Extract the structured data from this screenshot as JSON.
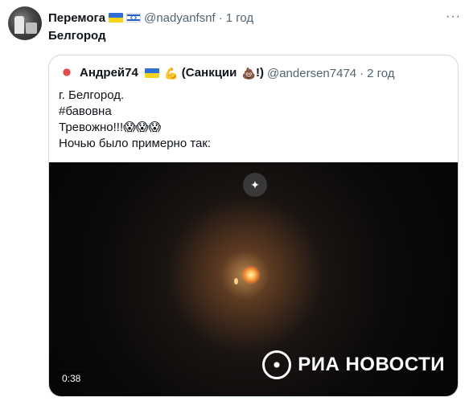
{
  "tweet": {
    "display_name": "Перемога",
    "handle": "@nadyanfsnf",
    "separator": "·",
    "time": "1 год",
    "text": "Белгород",
    "more_icon": "more-dots-icon"
  },
  "quote": {
    "display_name": "Андрей74",
    "sanctions_open": "(Санкции",
    "sanctions_close": "!)",
    "handle": "@andersen7474",
    "separator": "·",
    "time": "2 год",
    "lines": [
      "г. Белгород.",
      "#бавовна",
      "Тревожно!!!😱😱😱",
      "Ночью было примерно так:"
    ],
    "emoji_muscle": "💪",
    "emoji_poop": "💩"
  },
  "video": {
    "duration": "0:38",
    "watermark": "РИА НОВОСТИ",
    "sparkle_icon": "✦"
  }
}
